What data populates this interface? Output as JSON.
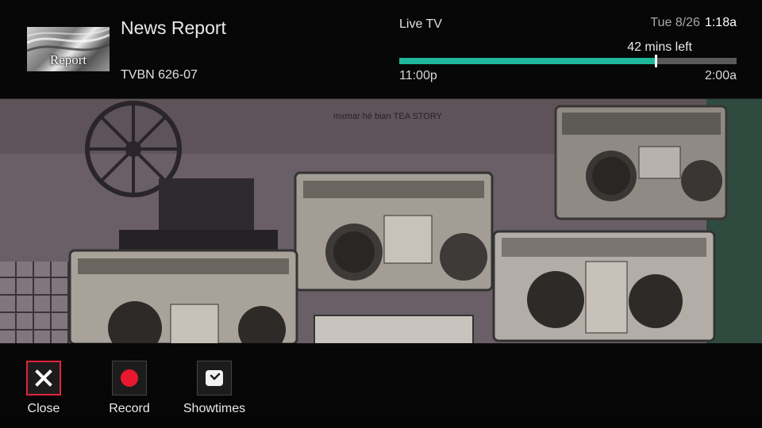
{
  "program": {
    "title": "News Report",
    "channel": "TVBN 626-07",
    "thumbnail_text": "Report"
  },
  "status": {
    "mode": "Live TV",
    "date": "Tue 8/26",
    "time": "1:18a",
    "remaining": "42 mins left",
    "start": "11:00p",
    "end": "2:00a",
    "progress_fraction": 0.76
  },
  "actions": [
    {
      "label": "Close",
      "icon": "close-icon",
      "selected": true
    },
    {
      "label": "Record",
      "icon": "record-icon",
      "selected": false
    },
    {
      "label": "Showtimes",
      "icon": "clock-icon",
      "selected": false
    }
  ],
  "colors": {
    "progress_fill": "#1fb89c",
    "progress_track": "#5a5a5a",
    "selection": "#e0233c",
    "record": "#e8182f"
  },
  "video": {
    "sign_text": "mxmar hé bian TEA STORY"
  }
}
